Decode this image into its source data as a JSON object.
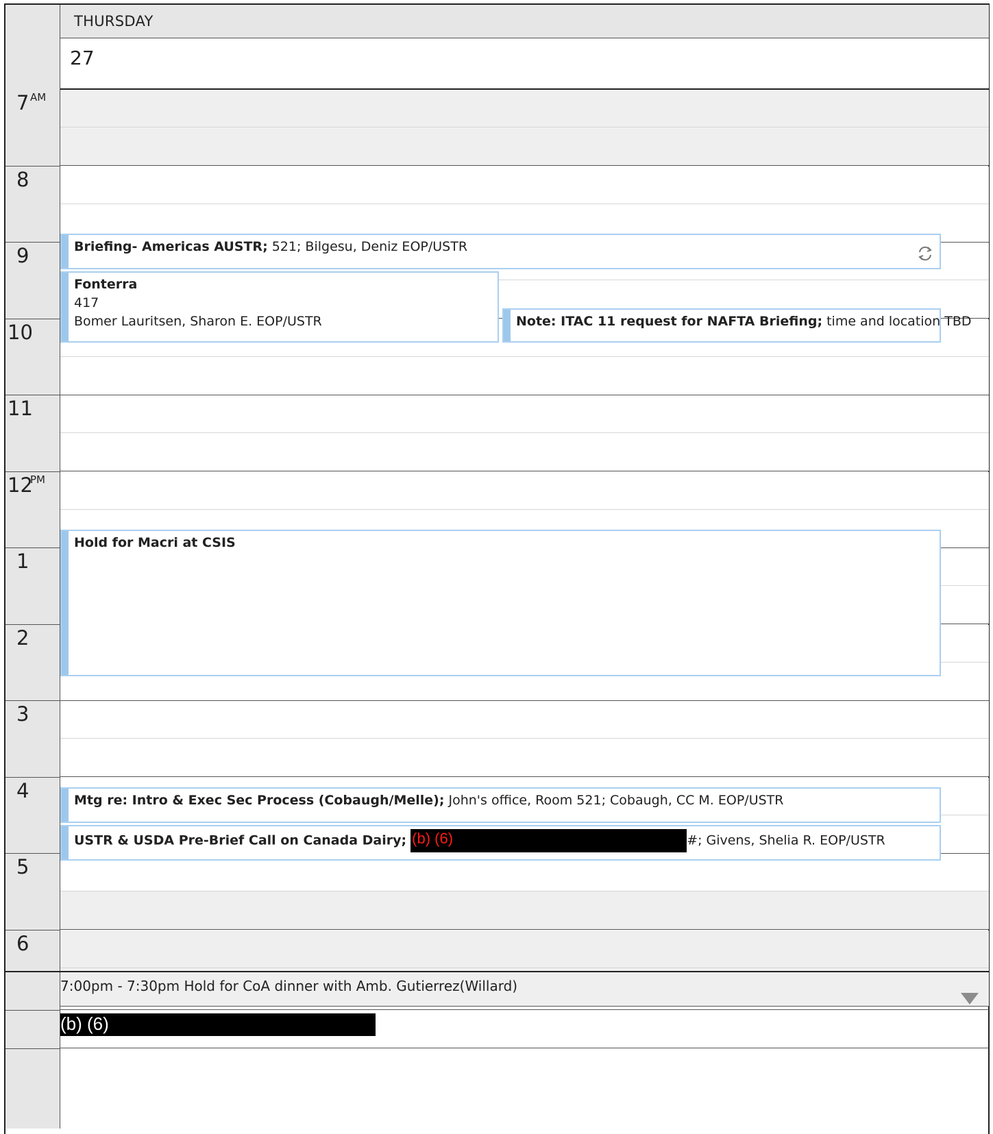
{
  "day": {
    "name": "THURSDAY",
    "date": "27"
  },
  "hours": [
    {
      "label": "7",
      "suffix": "AM"
    },
    {
      "label": "8",
      "suffix": ""
    },
    {
      "label": "9",
      "suffix": ""
    },
    {
      "label": "10",
      "suffix": ""
    },
    {
      "label": "11",
      "suffix": ""
    },
    {
      "label": "12",
      "suffix": "PM"
    },
    {
      "label": "1",
      "suffix": ""
    },
    {
      "label": "2",
      "suffix": ""
    },
    {
      "label": "3",
      "suffix": ""
    },
    {
      "label": "4",
      "suffix": ""
    },
    {
      "label": "5",
      "suffix": ""
    },
    {
      "label": "6",
      "suffix": ""
    }
  ],
  "events": {
    "briefing": {
      "title": "Briefing- Americas AUSTR;",
      "details": " 521; Bilgesu, Deniz EOP/USTR",
      "icon": "recurring-icon"
    },
    "fonterra": {
      "title": "Fonterra",
      "location": "417",
      "organizer": "Bomer Lauritsen, Sharon E. EOP/USTR"
    },
    "itac": {
      "title": "Note: ITAC 11 request for NAFTA Briefing;",
      "details": " time and location TBD"
    },
    "macri": {
      "title": "Hold for Macri at CSIS"
    },
    "mtg": {
      "title": "Mtg re: Intro & Exec Sec Process (Cobaugh/Melle);",
      "details": " John's office, Room 521; Cobaugh, CC M. EOP/USTR"
    },
    "dairy": {
      "title": "USTR & USDA Pre-Brief Call on Canada Dairy;",
      "redaction": "(b) (6)",
      "details": "#; Givens, Shelia R. EOP/USTR"
    }
  },
  "below": {
    "line1": "7:00pm - 7:30pm Hold for CoA dinner with Amb. Gutierrez(Willard)",
    "redaction": "(b) (6)"
  }
}
